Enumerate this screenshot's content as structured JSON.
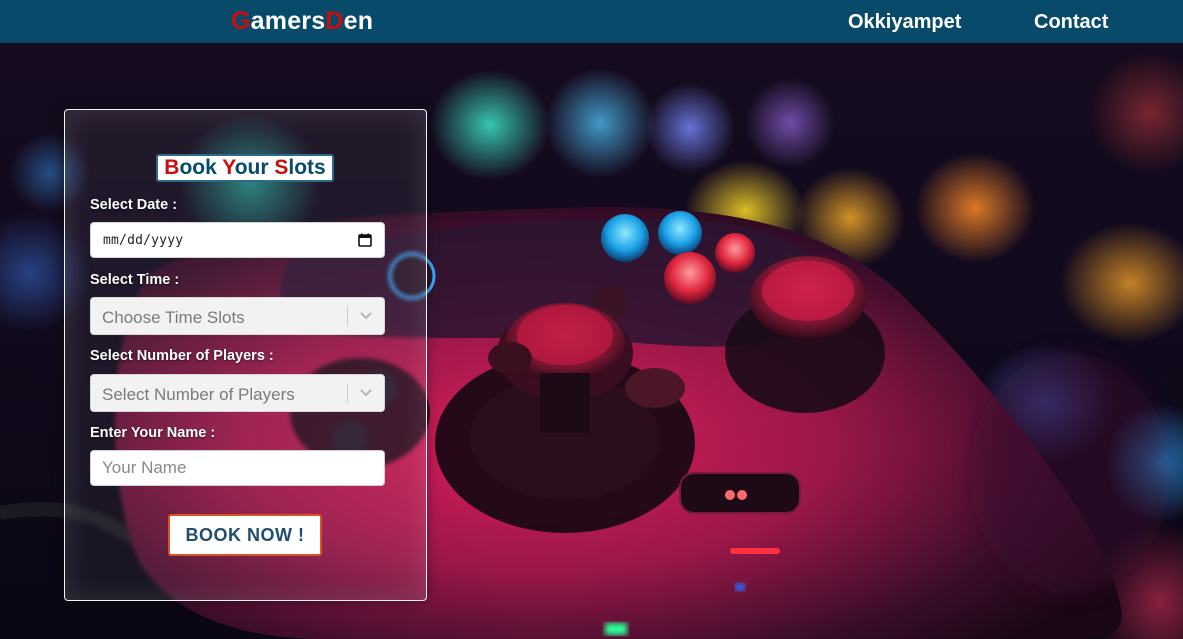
{
  "navbar": {
    "brand": {
      "letter_1": "G",
      "part_1": "amers",
      "letter_2": "D",
      "part_2": "en"
    },
    "links": {
      "location": "Okkiyampet",
      "contact": "Contact"
    }
  },
  "booking": {
    "title": {
      "b": "B",
      "ook": "ook ",
      "y": "Y",
      "our": "our ",
      "s": "S",
      "lots": "lots"
    },
    "date_label": "Select Date :",
    "date_placeholder": "mm/dd/yyyy",
    "time_label": "Select Time :",
    "time_selected": "Choose Time Slots",
    "players_label": "Select Number of Players :",
    "players_selected": "Select Number of Players",
    "name_label": "Enter Your Name :",
    "name_placeholder": "Your Name",
    "button_label": "BOOK NOW !"
  },
  "colors": {
    "navbar_bg": "#074a6a",
    "brand_accent": "#c90e0e",
    "button_border": "#d9531e",
    "button_text": "#1f4e6e"
  },
  "icons": {
    "date": "calendar-icon",
    "select": "chevron-down-icon"
  }
}
